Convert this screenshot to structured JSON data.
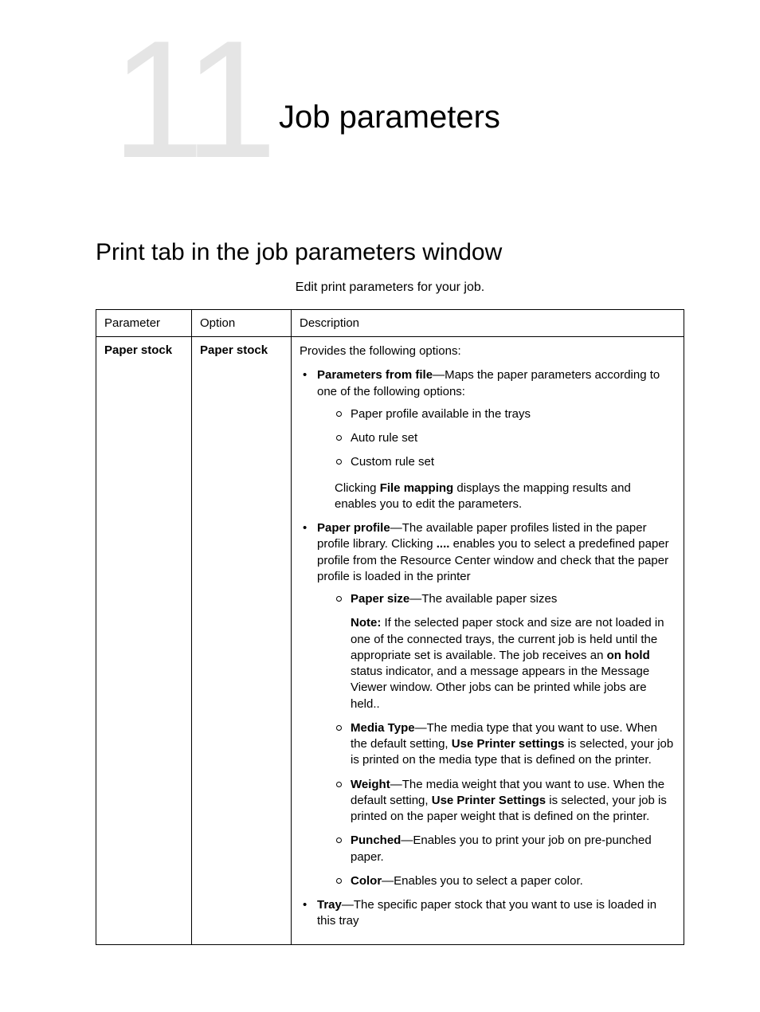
{
  "chapter": {
    "number": "11",
    "title": "Job parameters"
  },
  "section": {
    "title": "Print tab in the job parameters window",
    "intro": "Edit print parameters for your job."
  },
  "table": {
    "headers": {
      "parameter": "Parameter",
      "option": "Option",
      "description": "Description"
    },
    "row": {
      "parameter": "Paper stock",
      "option": "Paper stock",
      "desc": {
        "intro": "Provides the following options:",
        "param_from_file_label": "Parameters from file",
        "param_from_file_text": "—Maps the paper parameters according to one of the following options:",
        "pff_sub1": "Paper profile available in the trays",
        "pff_sub2": "Auto rule set",
        "pff_sub3": "Custom rule set",
        "file_mapping_pre": "Clicking ",
        "file_mapping_bold": "File mapping",
        "file_mapping_post": " displays the mapping results and enables you to edit the parameters.",
        "paper_profile_label": "Paper profile",
        "paper_profile_text_a": "—The available paper profiles listed in the paper profile library. Clicking ",
        "paper_profile_ellipsis": "....",
        "paper_profile_text_b": " enables you to select a predefined paper profile from the Resource Center window and check that the paper profile is loaded in the printer",
        "paper_size_label": "Paper size",
        "paper_size_text": "—The available paper sizes",
        "note_label": "Note:",
        "note_text_a": " If the selected paper stock and size are not loaded in one of the connected trays, the current job is held until the appropriate set is available. The job receives an ",
        "note_bold": "on hold",
        "note_text_b": " status indicator, and a message appears in the Message Viewer window. Other jobs can be printed while jobs are held..",
        "media_type_label": "Media Type",
        "media_type_text_a": "—The media type that you want to use. When the default setting, ",
        "media_type_bold": "Use Printer settings",
        "media_type_text_b": " is selected, your job is printed on the media type that is defined on the printer.",
        "weight_label": "Weight",
        "weight_text_a": "—The media weight that you want to use. When the default setting, ",
        "weight_bold": "Use Printer Settings",
        "weight_text_b": " is selected, your job is printed on the paper weight that is defined on the printer.",
        "punched_label": "Punched",
        "punched_text": "—Enables you to print your job on pre-punched paper.",
        "color_label": "Color",
        "color_text": "—Enables you to select a paper color.",
        "tray_label": "Tray",
        "tray_text": "—The specific paper stock that you want to use is loaded in this tray"
      }
    }
  }
}
